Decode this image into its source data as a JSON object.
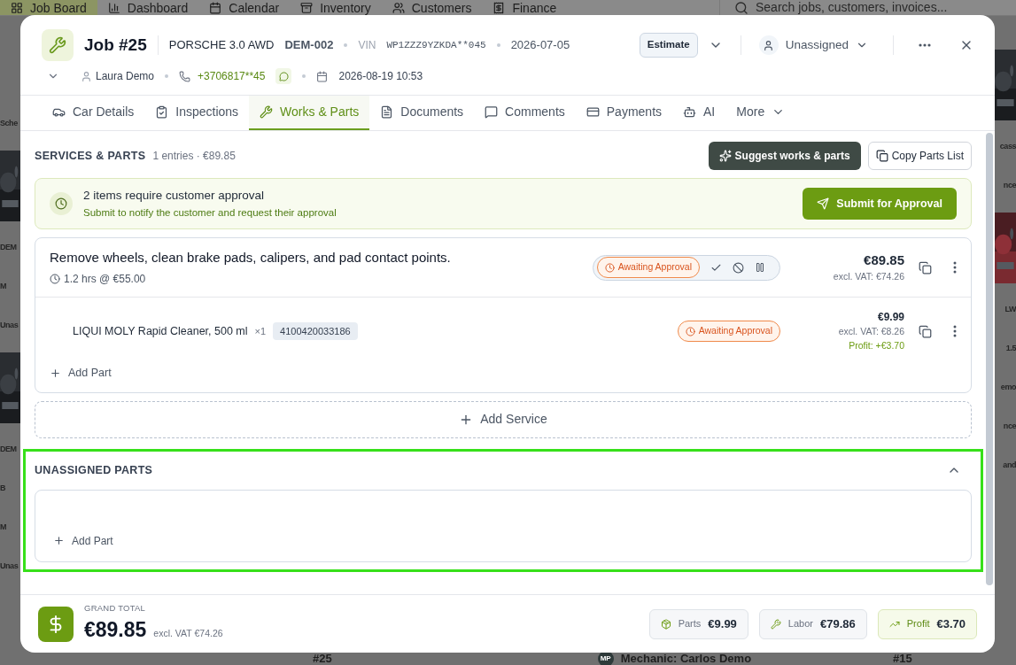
{
  "background": {
    "nav": [
      {
        "kind": "board",
        "label": "Job Board",
        "selected": true
      },
      {
        "kind": "dashboard",
        "label": "Dashboard",
        "selected": false
      },
      {
        "kind": "calendar",
        "label": "Calendar",
        "selected": false
      },
      {
        "kind": "inventory",
        "label": "Inventory",
        "selected": false
      },
      {
        "kind": "customers",
        "label": "Customers",
        "selected": false
      },
      {
        "kind": "finance",
        "label": "Finance",
        "selected": false
      }
    ],
    "search": {
      "placeholder": "Search jobs, customers, invoices..."
    },
    "left_fragments": [
      {
        "kind": "text",
        "text": "Sche"
      },
      {
        "kind": "picture"
      },
      {
        "kind": "text",
        "text": "DEM"
      },
      {
        "kind": "text",
        "text": "M"
      },
      {
        "kind": "text",
        "text": "Unas"
      },
      {
        "kind": "picture"
      },
      {
        "kind": "text",
        "text": "DEM"
      },
      {
        "kind": "text",
        "text": "B"
      },
      {
        "kind": "text",
        "text": "M"
      },
      {
        "kind": "text",
        "text": "Unas"
      }
    ],
    "right_fragments": [
      {
        "kind": "picture"
      },
      {
        "kind": "text",
        "text": "cass"
      },
      {
        "kind": "text",
        "text": "nce"
      },
      {
        "kind": "picture"
      },
      {
        "kind": "text",
        "text": "LW"
      },
      {
        "kind": "text",
        "text": "1.5"
      },
      {
        "kind": "text",
        "text": "emo"
      },
      {
        "kind": "text",
        "text": "nce"
      },
      {
        "kind": "text",
        "text": "and"
      }
    ],
    "bottom_fragments": [
      {
        "kind": "text",
        "text": "#25"
      },
      {
        "kind": "avatar",
        "text": "MP"
      },
      {
        "kind": "text",
        "text": "Mechanic: Carlos Demo"
      },
      {
        "kind": "text",
        "text": "#15"
      }
    ]
  },
  "job": {
    "title": "Job #25",
    "car": "PORSCHE 3.0 AWD",
    "plate": "DEM-002",
    "vin_label": "VIN",
    "vin": "WP1ZZZ9YZKDA**045",
    "date": "2026-07-05",
    "status": "Estimate",
    "assignee": "Unassigned",
    "customer": "Laura Demo",
    "phone": "+3706817**45",
    "datetime": "2026-08-19 10:53"
  },
  "tabs": [
    {
      "kind": "car",
      "label": "Car Details",
      "selected": false
    },
    {
      "kind": "inspections",
      "label": "Inspections",
      "selected": false
    },
    {
      "kind": "works",
      "label": "Works & Parts",
      "selected": true
    },
    {
      "kind": "documents",
      "label": "Documents",
      "selected": false
    },
    {
      "kind": "comments",
      "label": "Comments",
      "selected": false
    },
    {
      "kind": "payments",
      "label": "Payments",
      "selected": false
    },
    {
      "kind": "ai",
      "label": "AI",
      "selected": false
    },
    {
      "kind": "more",
      "label": "More",
      "selected": false
    }
  ],
  "services_section": {
    "title": "SERVICES & PARTS",
    "summary": "1 entries · €89.85",
    "suggest_button": "Suggest works & parts",
    "copy_button": "Copy Parts List"
  },
  "approval_banner": {
    "title": "2 items require customer approval",
    "text": "Submit to notify the customer and request their approval",
    "button": "Submit for Approval"
  },
  "services": [
    {
      "description": "Remove wheels, clean brake pads, calipers, and pad contact points.",
      "time": "1.2 hrs @ €55.00",
      "status": "Awaiting Approval",
      "price": "€89.85",
      "excl_vat": "excl. VAT: €74.26",
      "parts": [
        {
          "name": "LIQUI MOLY Rapid Cleaner, 500 ml",
          "qty": "×1",
          "sku": "4100420033186",
          "status": "Awaiting Approval",
          "price": "€9.99",
          "excl_vat": "excl. VAT: €8.26",
          "profit": "Profit: +€3.70"
        }
      ],
      "add_part": "Add Part"
    }
  ],
  "add_service": "Add Service",
  "unassigned": {
    "title": "UNASSIGNED PARTS",
    "expanded": true,
    "highlighted": true,
    "add_part": "Add Part"
  },
  "footer": {
    "label": "GRAND TOTAL",
    "total": "€89.85",
    "excl_vat": "excl. VAT €74.26",
    "chips": [
      {
        "kind": "parts",
        "label": "Parts",
        "value": "€9.99"
      },
      {
        "kind": "labor",
        "label": "Labor",
        "value": "€79.86"
      },
      {
        "kind": "profit",
        "label": "Profit",
        "value": "€3.70"
      }
    ]
  }
}
